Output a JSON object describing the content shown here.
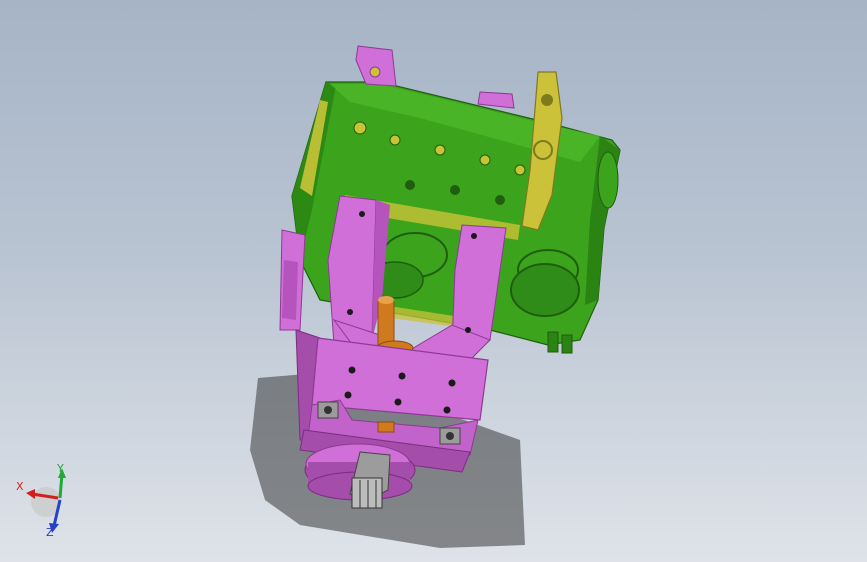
{
  "viewport": {
    "background_top": "#a6b4c6",
    "background_bottom": "#dfe3e9",
    "model_colors": {
      "block_green": "#3ba41c",
      "block_dark_green": "#1f6e10",
      "fixture_magenta": "#cf6fd7",
      "fixture_shadow": "#a44dab",
      "bracket_yellow": "#cbc23a",
      "pin_orange": "#d07a20",
      "steel_gray": "#9c9c9c"
    }
  },
  "triad": {
    "x_label": "X",
    "y_label": "Y",
    "z_label": "Z",
    "x_color": "#d11f1f",
    "y_color": "#23a83a",
    "z_color": "#2442c7"
  }
}
